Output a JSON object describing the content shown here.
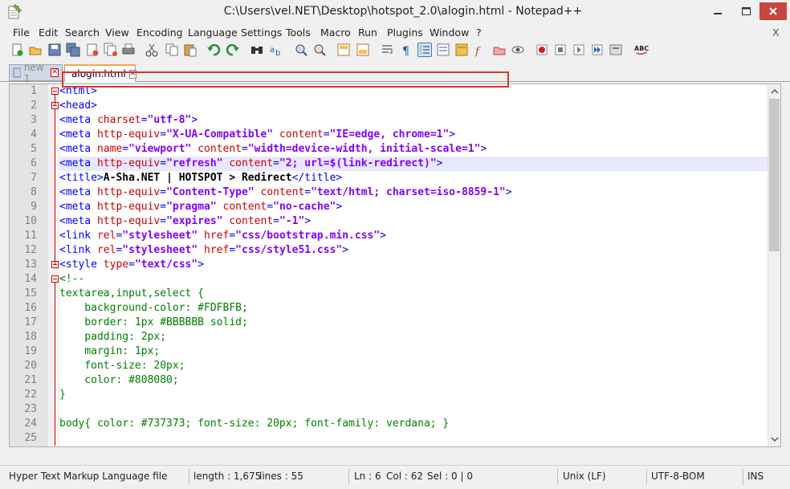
{
  "window": {
    "title": "C:\\Users\\vel.NET\\Desktop\\hotspot_2.0\\alogin.html - Notepad++",
    "colors": {
      "close_button": "#c7463d",
      "tab_accent": "#f9a25a",
      "highlight_box": "#e0302a"
    }
  },
  "menu": {
    "items": [
      "File",
      "Edit",
      "Search",
      "View",
      "Encoding",
      "Language",
      "Settings",
      "Tools",
      "Macro",
      "Run",
      "Plugins",
      "Window",
      "?"
    ],
    "close_label": "X"
  },
  "toolbar": {
    "icons": [
      "new-file-icon",
      "open-file-icon",
      "save-icon",
      "save-all-icon",
      "close-icon",
      "close-all-icon",
      "print-icon",
      "cut-icon",
      "copy-icon",
      "paste-icon",
      "undo-icon",
      "redo-icon",
      "find-icon",
      "replace-icon",
      "zoom-in-icon",
      "zoom-out-icon",
      "sync-vertical-icon",
      "sync-horizontal-icon",
      "word-wrap-icon",
      "show-all-chars-icon",
      "indent-guide-icon",
      "udl-icon",
      "doc-map-icon",
      "function-list-icon",
      "folder-workspace-icon",
      "monitor-icon",
      "record-macro-icon",
      "stop-macro-icon",
      "play-macro-icon",
      "run-macro-multiple-icon",
      "save-macro-icon",
      "spellcheck-icon"
    ]
  },
  "tabs": [
    {
      "label": "new 1",
      "active": false
    },
    {
      "label": "alogin.html",
      "active": true
    }
  ],
  "editor": {
    "current_line": 6,
    "lines": [
      {
        "n": "1",
        "parts": [
          [
            "tag",
            "<html>"
          ]
        ]
      },
      {
        "n": "2",
        "parts": [
          [
            "tag",
            "<head>"
          ]
        ]
      },
      {
        "n": "3",
        "parts": [
          [
            "tag",
            "<meta "
          ],
          [
            "attr",
            "charset"
          ],
          [
            "tag",
            "="
          ],
          [
            "val",
            "\"utf-8\""
          ],
          [
            "tag",
            ">"
          ]
        ]
      },
      {
        "n": "4",
        "parts": [
          [
            "tag",
            "<meta "
          ],
          [
            "attr",
            "http-equiv"
          ],
          [
            "tag",
            "="
          ],
          [
            "val",
            "\"X-UA-Compatible\""
          ],
          [
            "tag",
            " "
          ],
          [
            "attr",
            "content"
          ],
          [
            "tag",
            "="
          ],
          [
            "val",
            "\"IE=edge, chrome=1\""
          ],
          [
            "tag",
            ">"
          ]
        ]
      },
      {
        "n": "5",
        "parts": [
          [
            "tag",
            "<meta "
          ],
          [
            "attr",
            "name"
          ],
          [
            "tag",
            "="
          ],
          [
            "val",
            "\"viewport\""
          ],
          [
            "tag",
            " "
          ],
          [
            "attr",
            "content"
          ],
          [
            "tag",
            "="
          ],
          [
            "val",
            "\"width=device-width, initial-scale=1\""
          ],
          [
            "tag",
            ">"
          ]
        ]
      },
      {
        "n": "6",
        "parts": [
          [
            "tag",
            "<meta "
          ],
          [
            "attr",
            "http-equiv"
          ],
          [
            "tag",
            "="
          ],
          [
            "val",
            "\"refresh\""
          ],
          [
            "tag",
            " "
          ],
          [
            "attr",
            "content"
          ],
          [
            "tag",
            "="
          ],
          [
            "val",
            "\"2; url=$(link-redirect)\""
          ],
          [
            "tag",
            ">"
          ]
        ]
      },
      {
        "n": "7",
        "parts": [
          [
            "tag",
            "<title>"
          ],
          [
            "txt",
            "A-Sha.NET | HOTSPOT > Redirect"
          ],
          [
            "tag",
            "</title>"
          ]
        ]
      },
      {
        "n": "8",
        "parts": [
          [
            "tag",
            "<meta "
          ],
          [
            "attr",
            "http-equiv"
          ],
          [
            "tag",
            "="
          ],
          [
            "val",
            "\"Content-Type\""
          ],
          [
            "tag",
            " "
          ],
          [
            "attr",
            "content"
          ],
          [
            "tag",
            "="
          ],
          [
            "val",
            "\"text/html; charset=iso-8859-1\""
          ],
          [
            "tag",
            ">"
          ]
        ]
      },
      {
        "n": "9",
        "parts": [
          [
            "tag",
            "<meta "
          ],
          [
            "attr",
            "http-equiv"
          ],
          [
            "tag",
            "="
          ],
          [
            "val",
            "\"pragma\""
          ],
          [
            "tag",
            " "
          ],
          [
            "attr",
            "content"
          ],
          [
            "tag",
            "="
          ],
          [
            "val",
            "\"no-cache\""
          ],
          [
            "tag",
            ">"
          ]
        ]
      },
      {
        "n": "10",
        "parts": [
          [
            "tag",
            "<meta "
          ],
          [
            "attr",
            "http-equiv"
          ],
          [
            "tag",
            "="
          ],
          [
            "val",
            "\"expires\""
          ],
          [
            "tag",
            " "
          ],
          [
            "attr",
            "content"
          ],
          [
            "tag",
            "="
          ],
          [
            "val",
            "\"-1\""
          ],
          [
            "tag",
            ">"
          ]
        ]
      },
      {
        "n": "11",
        "parts": [
          [
            "tag",
            "<link "
          ],
          [
            "attr",
            "rel"
          ],
          [
            "tag",
            "="
          ],
          [
            "val",
            "\"stylesheet\""
          ],
          [
            "tag",
            " "
          ],
          [
            "attr",
            "href"
          ],
          [
            "tag",
            "="
          ],
          [
            "val",
            "\"css/bootstrap.min.css\""
          ],
          [
            "tag",
            ">"
          ]
        ]
      },
      {
        "n": "12",
        "parts": [
          [
            "tag",
            "<link "
          ],
          [
            "attr",
            "rel"
          ],
          [
            "tag",
            "="
          ],
          [
            "val",
            "\"stylesheet\""
          ],
          [
            "tag",
            " "
          ],
          [
            "attr",
            "href"
          ],
          [
            "tag",
            "="
          ],
          [
            "val",
            "\"css/style51.css\""
          ],
          [
            "tag",
            ">"
          ]
        ]
      },
      {
        "n": "13",
        "parts": [
          [
            "tag",
            "<style "
          ],
          [
            "attr",
            "type"
          ],
          [
            "tag",
            "="
          ],
          [
            "val",
            "\"text/css\""
          ],
          [
            "tag",
            ">"
          ]
        ]
      },
      {
        "n": "14",
        "parts": [
          [
            "cmt",
            "<!--"
          ]
        ]
      },
      {
        "n": "15",
        "parts": [
          [
            "cmt",
            "textarea,input,select {"
          ]
        ]
      },
      {
        "n": "16",
        "parts": [
          [
            "cmt",
            "    background-color: #FDFBFB;"
          ]
        ]
      },
      {
        "n": "17",
        "parts": [
          [
            "cmt",
            "    border: 1px #BBBBBB solid;"
          ]
        ]
      },
      {
        "n": "18",
        "parts": [
          [
            "cmt",
            "    padding: 2px;"
          ]
        ]
      },
      {
        "n": "19",
        "parts": [
          [
            "cmt",
            "    margin: 1px;"
          ]
        ]
      },
      {
        "n": "20",
        "parts": [
          [
            "cmt",
            "    font-size: 20px;"
          ]
        ]
      },
      {
        "n": "21",
        "parts": [
          [
            "cmt",
            "    color: #808080;"
          ]
        ]
      },
      {
        "n": "22",
        "parts": [
          [
            "cmt",
            "}"
          ]
        ]
      },
      {
        "n": "23",
        "parts": []
      },
      {
        "n": "24",
        "parts": [
          [
            "cmt",
            "body{ color: #737373; font-size: 20px; font-family: verdana; }"
          ]
        ]
      },
      {
        "n": "25",
        "parts": []
      }
    ]
  },
  "status": {
    "file_type": "Hyper Text Markup Language file",
    "length": "length : 1,675",
    "lines": "lines : 55",
    "ln": "Ln : 6",
    "col": "Col : 62",
    "sel": "Sel : 0 | 0",
    "eol": "Unix (LF)",
    "encoding": "UTF-8-BOM",
    "mode": "INS"
  }
}
